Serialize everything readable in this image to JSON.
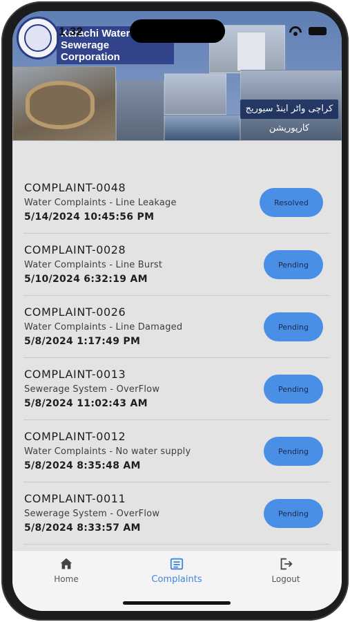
{
  "status_bar": {
    "time": "1:32"
  },
  "header": {
    "org_name_line1": "Karachi Water",
    "org_name_line2": "Sewerage Corporation",
    "urdu_name": "کراچی واٹر اینڈ سیوریج کارپوریشن"
  },
  "complaints": [
    {
      "id": "COMPLAINT-0048",
      "category": "Water Complaints - Line Leakage",
      "datetime": "5/14/2024 10:45:56 PM",
      "status": "Resolved"
    },
    {
      "id": "COMPLAINT-0028",
      "category": "Water Complaints - Line Burst",
      "datetime": "5/10/2024 6:32:19 AM",
      "status": "Pending"
    },
    {
      "id": "COMPLAINT-0026",
      "category": "Water Complaints - Line Damaged",
      "datetime": "5/8/2024 1:17:49 PM",
      "status": "Pending"
    },
    {
      "id": "COMPLAINT-0013",
      "category": "Sewerage System - OverFlow",
      "datetime": "5/8/2024 11:02:43 AM",
      "status": "Pending"
    },
    {
      "id": "COMPLAINT-0012",
      "category": "Water Complaints - No water supply",
      "datetime": "5/8/2024 8:35:48 AM",
      "status": "Pending"
    },
    {
      "id": "COMPLAINT-0011",
      "category": "Sewerage System - OverFlow",
      "datetime": "5/8/2024 8:33:57 AM",
      "status": "Pending"
    }
  ],
  "bottom_nav": {
    "home_label": "Home",
    "complaints_label": "Complaints",
    "logout_label": "Logout",
    "active": "Complaints"
  },
  "colors": {
    "badge": "#4a8fe6",
    "active_tab": "#3e86d9",
    "list_bg": "#e3e3e4"
  },
  "icons": {
    "home": "home-icon",
    "complaints": "list-icon",
    "logout": "logout-icon"
  }
}
